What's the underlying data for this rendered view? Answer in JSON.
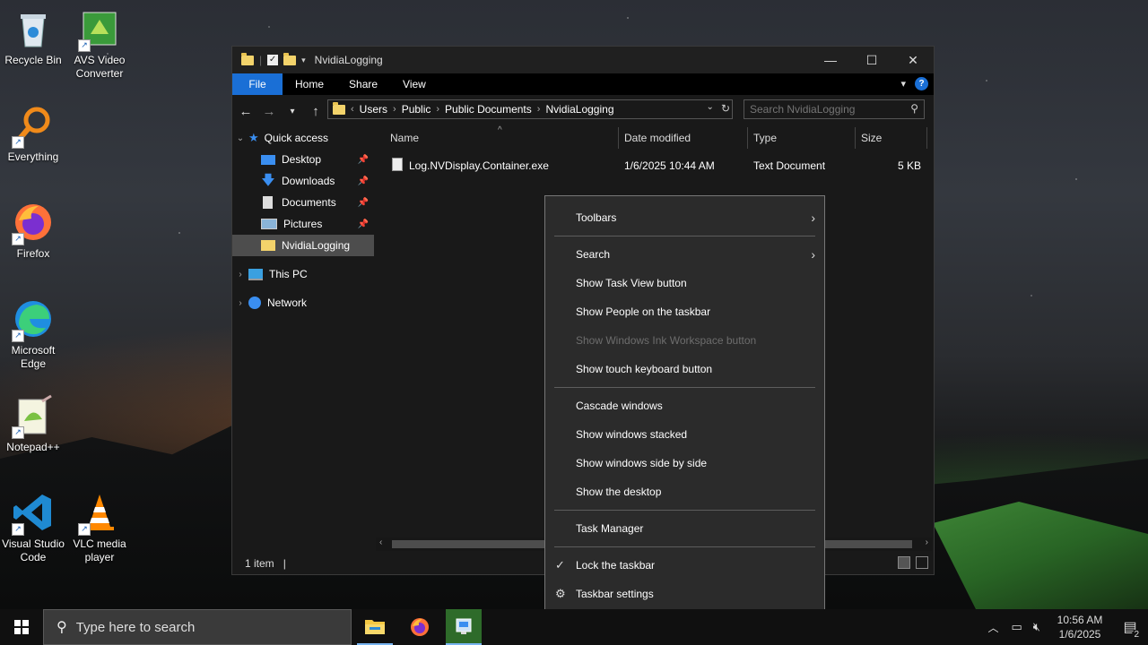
{
  "desktop": {
    "icons": [
      {
        "label": "Recycle Bin"
      },
      {
        "label": "AVS Video Converter"
      },
      {
        "label": "Everything"
      },
      {
        "label": "Firefox"
      },
      {
        "label": "Microsoft Edge"
      },
      {
        "label": "Notepad++"
      },
      {
        "label": "Visual Studio Code"
      },
      {
        "label": "VLC media player"
      }
    ]
  },
  "explorer": {
    "title": "NvidiaLogging",
    "ribbon_tabs": [
      "File",
      "Home",
      "Share",
      "View"
    ],
    "breadcrumb": [
      "Users",
      "Public",
      "Public Documents",
      "NvidiaLogging"
    ],
    "search_placeholder": "Search NvidiaLogging",
    "nav": {
      "quick_access": "Quick access",
      "items": [
        "Desktop",
        "Downloads",
        "Documents",
        "Pictures",
        "NvidiaLogging"
      ],
      "this_pc": "This PC",
      "network": "Network"
    },
    "columns": [
      "Name",
      "Date modified",
      "Type",
      "Size"
    ],
    "files": [
      {
        "name": "Log.NVDisplay.Container.exe",
        "date": "1/6/2025 10:44 AM",
        "type": "Text Document",
        "size": "5 KB"
      }
    ],
    "status": "1 item"
  },
  "context_menu": {
    "items": [
      {
        "label": "Toolbars"
      },
      {
        "label": "Search"
      },
      {
        "label": "Show Task View button"
      },
      {
        "label": "Show People on the taskbar"
      },
      {
        "label": "Show Windows Ink Workspace button"
      },
      {
        "label": "Show touch keyboard button"
      },
      {
        "label": "Cascade windows"
      },
      {
        "label": "Show windows stacked"
      },
      {
        "label": "Show windows side by side"
      },
      {
        "label": "Show the desktop"
      },
      {
        "label": "Task Manager"
      },
      {
        "label": "Lock the taskbar"
      },
      {
        "label": "Taskbar settings"
      }
    ]
  },
  "taskbar": {
    "search_placeholder": "Type here to search",
    "time": "10:56 AM",
    "date": "1/6/2025",
    "notification_count": "2"
  },
  "colors": {
    "accent": "#1a6fd6",
    "menu_bg": "#2b2b2b",
    "window_bg": "#191919"
  }
}
